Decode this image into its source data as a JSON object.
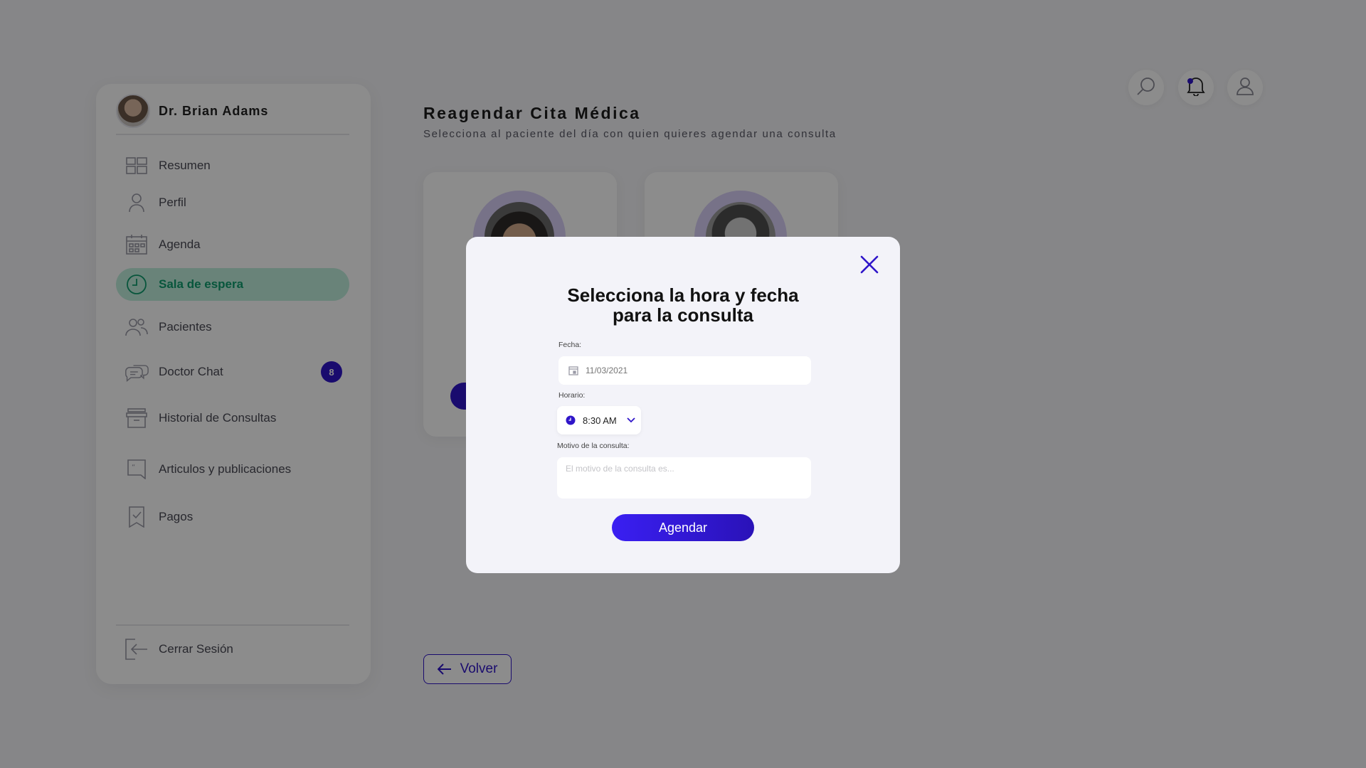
{
  "sidebar": {
    "doctor_name": "Dr. Brian Adams",
    "items": [
      {
        "label": "Resumen",
        "icon": "dashboard-icon"
      },
      {
        "label": "Perfil",
        "icon": "user-icon"
      },
      {
        "label": "Agenda",
        "icon": "calendar-icon"
      },
      {
        "label": "Sala de espera",
        "icon": "clock-icon",
        "active": true
      },
      {
        "label": "Pacientes",
        "icon": "users-icon"
      },
      {
        "label": "Doctor Chat",
        "icon": "chat-icon",
        "badge": "8"
      },
      {
        "label": "Historial de Consultas",
        "icon": "archive-icon"
      },
      {
        "label": "Articulos y publicaciones",
        "icon": "article-icon"
      },
      {
        "label": "Pagos",
        "icon": "receipt-icon"
      }
    ],
    "logout_label": "Cerrar Sesión"
  },
  "header": {
    "title": "Reagendar Cita Médica",
    "subtitle": "Selecciona al paciente del día con quien quieres agendar una consulta",
    "icons": [
      "search-icon",
      "bell-icon",
      "account-icon"
    ]
  },
  "main": {
    "back_label": "Volver"
  },
  "modal": {
    "title_line1": "Selecciona la hora y fecha",
    "title_line2": "para la consulta",
    "date_label": "Fecha:",
    "date_placeholder": "11/03/2021",
    "time_label": "Horario:",
    "time_value": "8:30 AM",
    "reason_label": "Motivo de la consulta:",
    "reason_placeholder": "El motivo de la consulta es...",
    "submit_label": "Agendar"
  },
  "colors": {
    "accent": "#2f15c9",
    "active_bg": "#bfeedd",
    "active_text": "#0f9d6e",
    "overlay": "rgba(0,0,0,0.45)"
  }
}
